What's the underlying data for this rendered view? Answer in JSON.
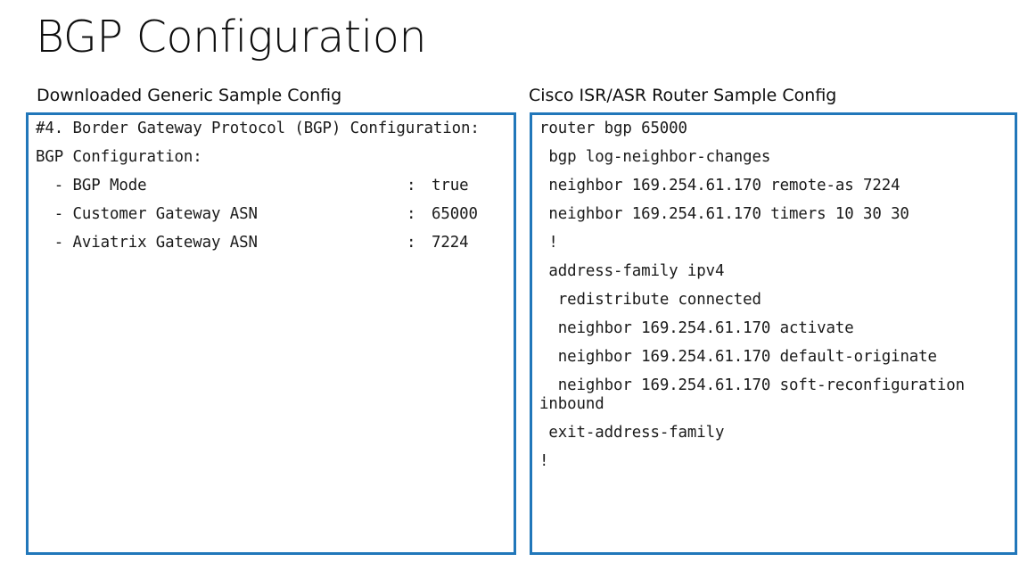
{
  "slide": {
    "title": "BGP Configuration",
    "background_color": "#FFFFFF",
    "accent_color": "#2177BA",
    "text_color": "#0D0D0D"
  },
  "left_panel": {
    "heading": "Downloaded Generic Sample Config",
    "header_lines": [
      "#4. Border Gateway Protocol (BGP) Configuration:",
      "BGP Configuration:"
    ],
    "rows": [
      {
        "key": "  - BGP Mode",
        "sep": ":",
        "value": "true"
      },
      {
        "key": "  - Customer Gateway ASN",
        "sep": ":",
        "value": "65000"
      },
      {
        "key": "  - Aviatrix Gateway ASN",
        "sep": ":",
        "value": "7224"
      }
    ]
  },
  "right_panel": {
    "heading": "Cisco ISR/ASR Router Sample Config",
    "lines": [
      "router bgp 65000",
      " bgp log-neighbor-changes",
      " neighbor 169.254.61.170 remote-as 7224",
      " neighbor 169.254.61.170 timers 10 30 30",
      " !",
      " address-family ipv4",
      "  redistribute connected",
      "  neighbor 169.254.61.170 activate",
      "  neighbor 169.254.61.170 default-originate",
      "  neighbor 169.254.61.170 soft-reconfiguration inbound",
      " exit-address-family",
      "!"
    ]
  }
}
